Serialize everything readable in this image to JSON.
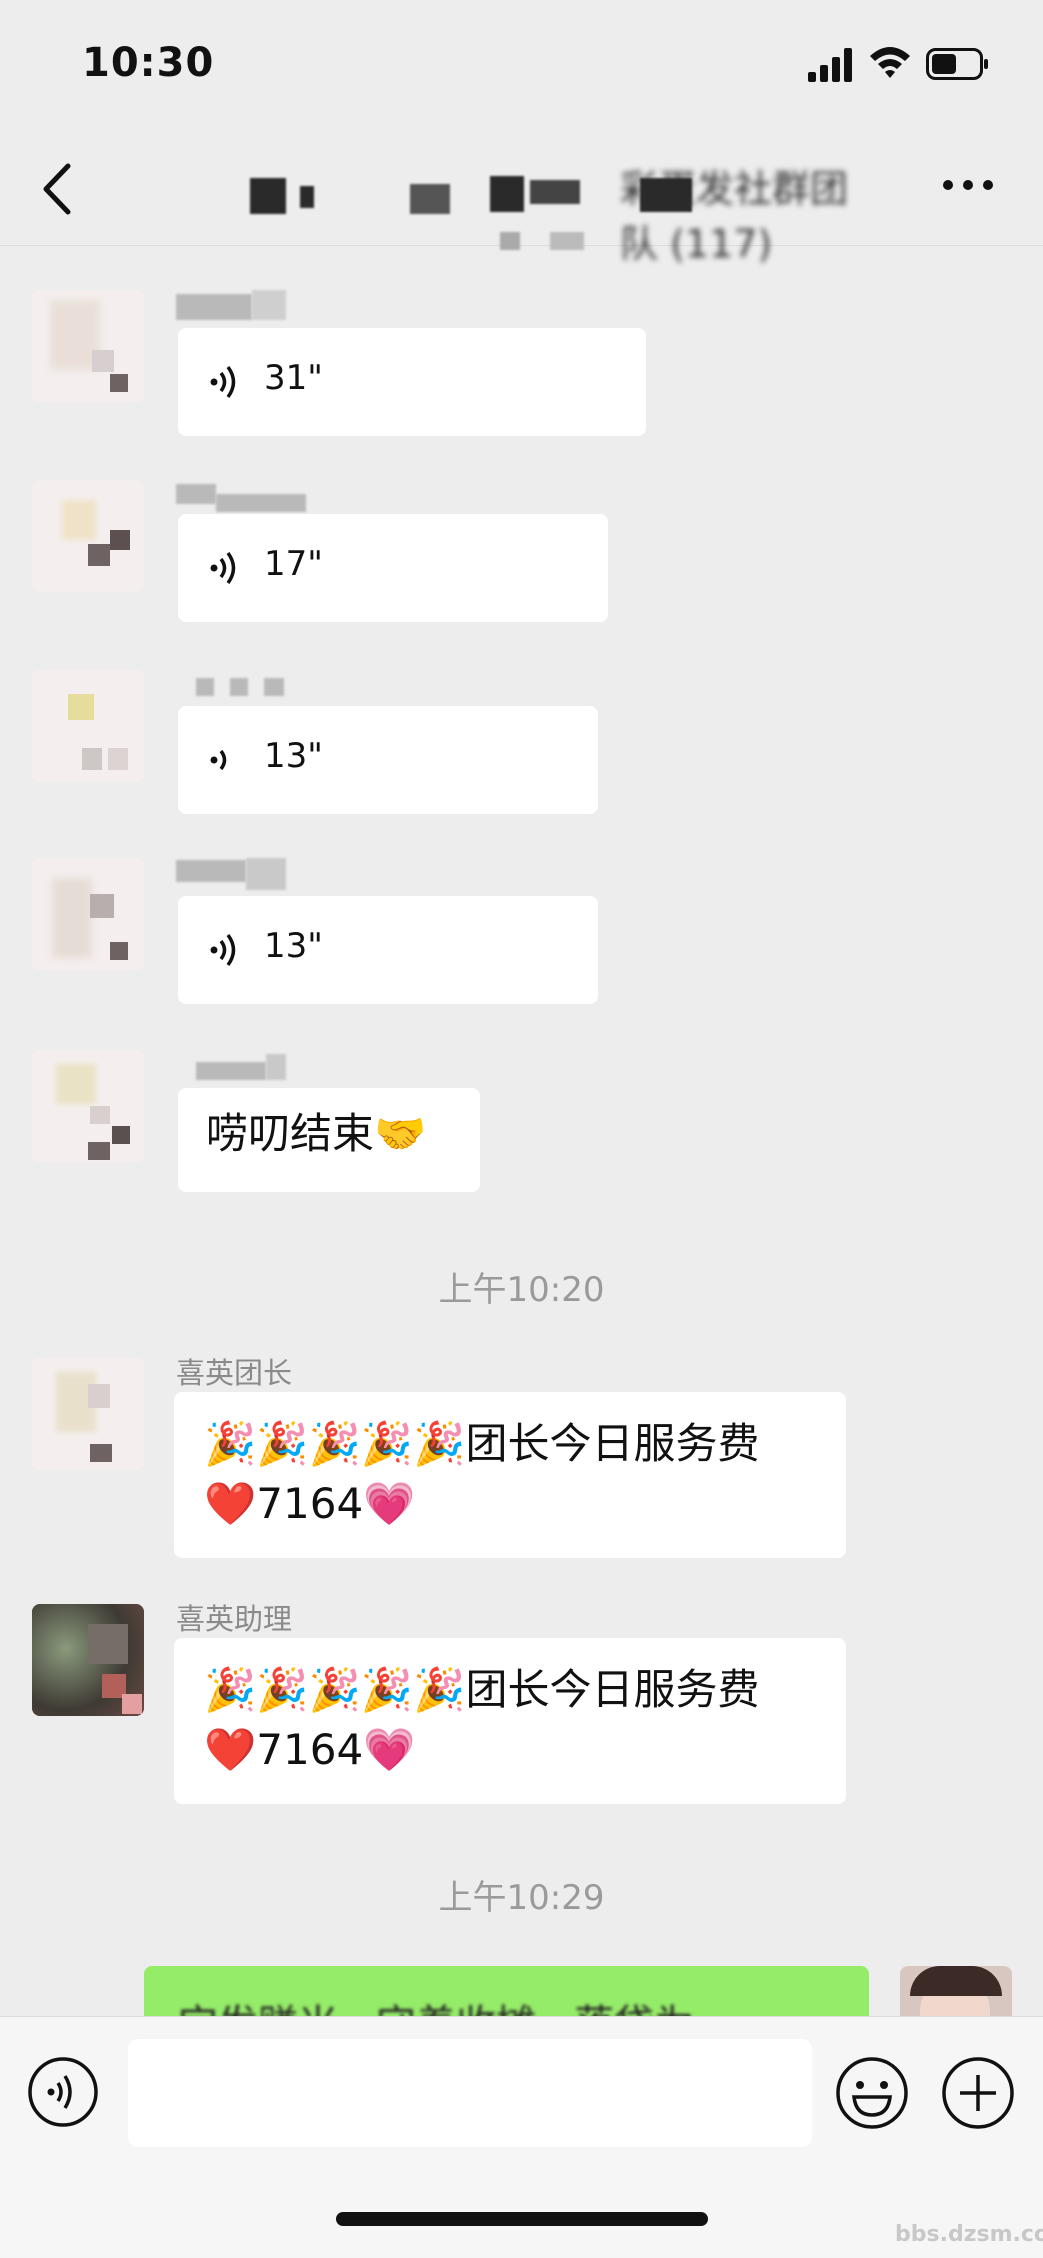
{
  "status_bar": {
    "time": "10:30"
  },
  "nav": {
    "title": "彩蛋发社群团队 (117)"
  },
  "messages": [
    {
      "type": "voice",
      "duration": "31\""
    },
    {
      "type": "voice",
      "duration": "17\""
    },
    {
      "type": "voice",
      "duration": "13\""
    },
    {
      "type": "voice",
      "duration": "13\""
    },
    {
      "type": "text",
      "text": "唠叨结束🤝"
    }
  ],
  "timestamp_1": "上午10:20",
  "msg_group_leader": {
    "sender": "喜英团长",
    "line1": "🎉🎉🎉🎉🎉团长今日服务费",
    "line2": "❤️7164💗"
  },
  "msg_assistant": {
    "sender": "喜英助理",
    "line1": "🎉🎉🎉🎉🎉团长今日服务费",
    "line2": "❤️7164💗"
  },
  "timestamp_2": "上午10:29",
  "self_message": {
    "text": "宝发赚米 · 守着收摊 · 落袋为"
  },
  "watermark": "bbs.dzsm.com",
  "colors": {
    "background": "#ededed",
    "self_bubble": "#95ec69",
    "other_bubble": "#ffffff",
    "timestamp": "#9a9a9a"
  }
}
